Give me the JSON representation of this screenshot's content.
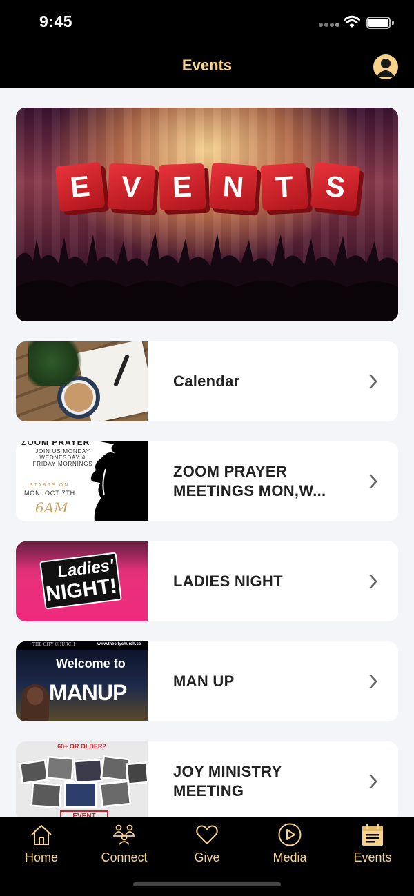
{
  "status": {
    "time": "9:45"
  },
  "header": {
    "title": "Events"
  },
  "hero": {
    "cube_letters": [
      "E",
      "V",
      "E",
      "N",
      "T",
      "S"
    ]
  },
  "events": [
    {
      "label": "Calendar"
    },
    {
      "label": "ZOOM PRAYER MEETINGS MON,W..."
    },
    {
      "label": "LADIES NIGHT"
    },
    {
      "label": "MAN UP"
    },
    {
      "label": "JOY MINISTRY MEETING"
    }
  ],
  "thumbs": {
    "zoom": {
      "line1": "JOIN US MONDAY",
      "line2": "WEDNESDAY &",
      "line3": "FRIDAY MORNINGS",
      "starts": "STARTS ON",
      "date": "MON, OCT 7TH",
      "time": "6AM",
      "header": "ZOOM PRAYER"
    },
    "ladies": {
      "line1": "Ladies'",
      "line2": "NIGHT!"
    },
    "manup": {
      "top_left": "THE CITY CHURCH",
      "top_right": "www.thecitychurch.co",
      "welcome": "Welcome to",
      "title": "MANUP"
    },
    "joy": {
      "header": "60+ OR OLDER?",
      "event": "EVENT"
    }
  },
  "tabs": [
    {
      "label": "Home",
      "icon": "home-icon"
    },
    {
      "label": "Connect",
      "icon": "connect-icon"
    },
    {
      "label": "Give",
      "icon": "heart-icon"
    },
    {
      "label": "Media",
      "icon": "play-icon"
    },
    {
      "label": "Events",
      "icon": "events-icon"
    }
  ],
  "colors": {
    "accent": "#f6d28b",
    "bar": "#000000",
    "background": "#f4f5f9"
  }
}
